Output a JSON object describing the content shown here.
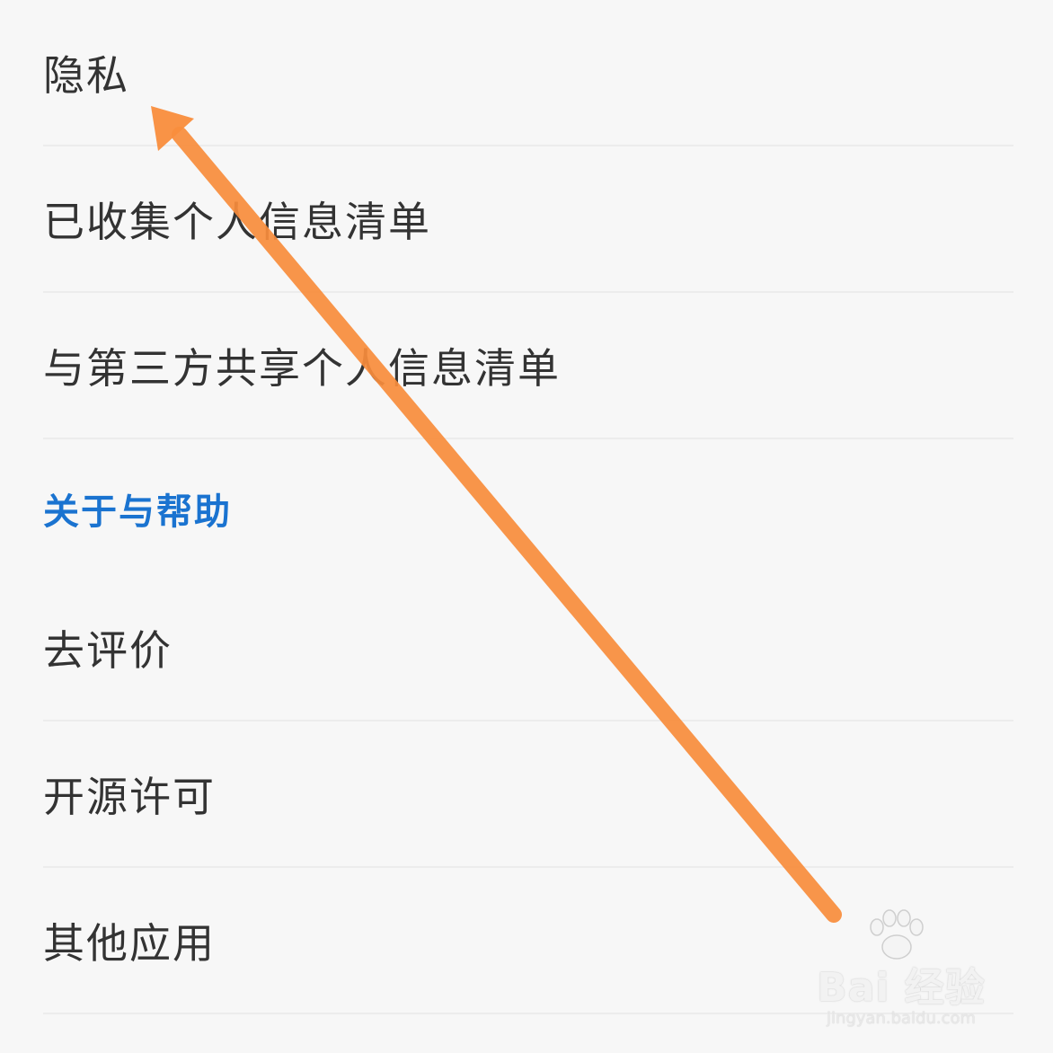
{
  "settings": {
    "items_top": [
      {
        "label": "隐私"
      },
      {
        "label": "已收集个人信息清单"
      },
      {
        "label": "与第三方共享个人信息清单"
      }
    ],
    "section_header": "关于与帮助",
    "items_bottom": [
      {
        "label": "去评价"
      },
      {
        "label": "开源许可"
      },
      {
        "label": "其他应用"
      }
    ]
  },
  "colors": {
    "background": "#f7f7f7",
    "text": "#333333",
    "section_header": "#1a73d0",
    "arrow": "#f98d3c",
    "divider": "#ececec"
  },
  "annotation": {
    "icon": "arrow-up-left-icon"
  },
  "watermark": {
    "brand": "Bai 经验",
    "url": "jingyan.baidu.com"
  }
}
